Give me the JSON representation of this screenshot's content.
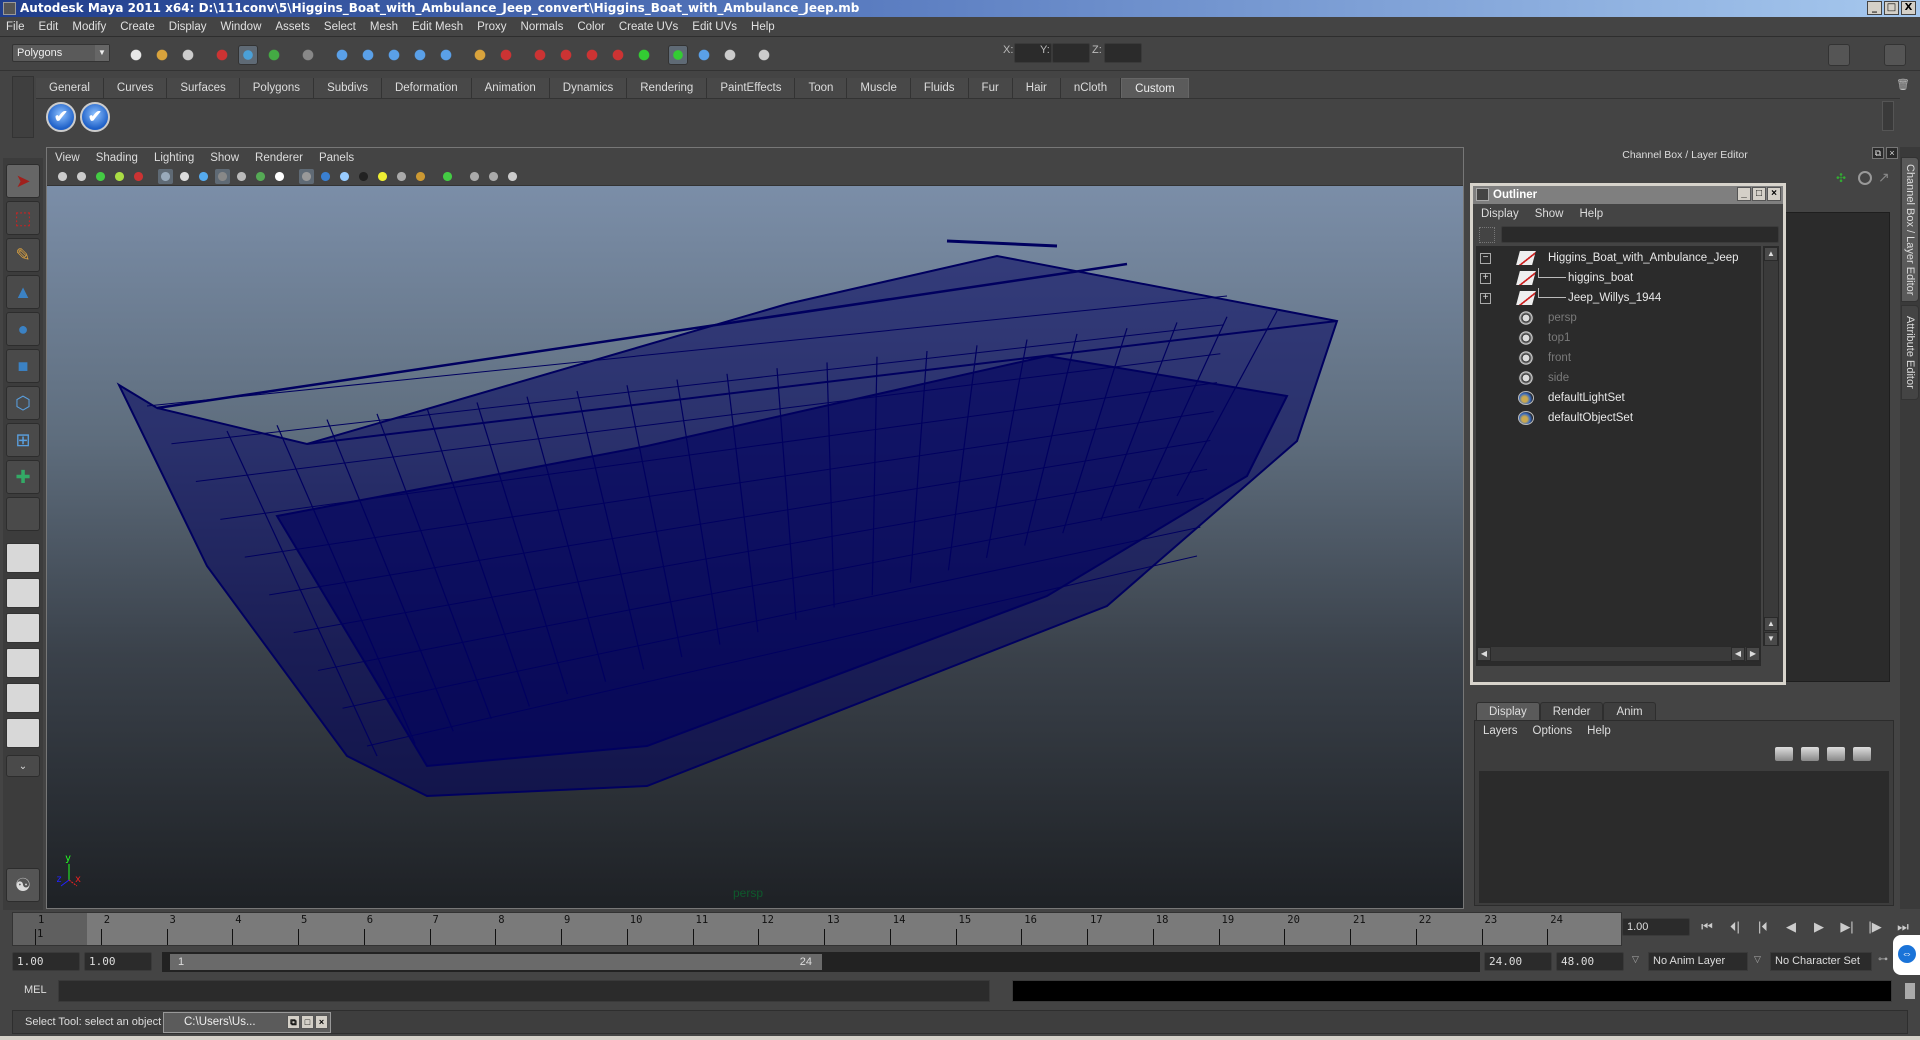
{
  "window": {
    "title": "Autodesk Maya 2011 x64: D:\\111conv\\5\\Higgins_Boat_with_Ambulance_Jeep_convert\\Higgins_Boat_with_Ambulance_Jeep.mb",
    "controls": {
      "minimize": "_",
      "maximize": "□",
      "close": "X"
    }
  },
  "menubar": [
    "File",
    "Edit",
    "Modify",
    "Create",
    "Display",
    "Window",
    "Assets",
    "Select",
    "Mesh",
    "Edit Mesh",
    "Proxy",
    "Normals",
    "Color",
    "Create UVs",
    "Edit UVs",
    "Help"
  ],
  "statusline": {
    "mode": "Polygons",
    "x_label": "X:",
    "y_label": "Y:",
    "z_label": "Z:",
    "x_value": "",
    "y_value": "",
    "z_value": "",
    "icons": [
      "new-scene-icon",
      "open-scene-icon",
      "save-scene-icon",
      "select-hierarchy-icon",
      "select-object-icon",
      "select-component-icon",
      "pick-mask-icon",
      "snap-grid-icon",
      "snap-curve-icon",
      "snap-point-icon",
      "snap-view-plane-icon",
      "snap-live-icon",
      "lock-icon",
      "selection-highlight-icon",
      "history-icon",
      "input-ops-icon",
      "output-ops-icon",
      "construction-history-icon",
      "render-view-icon",
      "render-current-icon",
      "ipr-render-icon",
      "render-settings-icon",
      "input-mode-icon"
    ],
    "right_icons": [
      "attribute-editor-toggle-icon",
      "tool-settings-toggle-icon",
      "channel-box-toggle-icon"
    ]
  },
  "shelf": {
    "tabs": [
      "General",
      "Curves",
      "Surfaces",
      "Polygons",
      "Subdivs",
      "Deformation",
      "Animation",
      "Dynamics",
      "Rendering",
      "PaintEffects",
      "Toon",
      "Muscle",
      "Fluids",
      "Fur",
      "Hair",
      "nCloth",
      "Custom"
    ],
    "active_tab": "Custom",
    "buttons": [
      "✔",
      "✔"
    ]
  },
  "toolbox": {
    "tools": [
      "select-tool-icon",
      "lasso-tool-icon",
      "paint-select-tool-icon",
      "move-tool-icon",
      "rotate-tool-icon",
      "scale-tool-icon",
      "universal-manipulator-icon",
      "soft-modification-icon",
      "show-manipulator-icon",
      "last-tool-icon"
    ],
    "layouts": [
      "single-perspective-layout",
      "four-view-layout",
      "persp-outliner-layout",
      "persp-graph-layout",
      "hypershade-persp-layout",
      "persp-graph-hypergraph-layout"
    ]
  },
  "viewport": {
    "menu": [
      "View",
      "Shading",
      "Lighting",
      "Show",
      "Renderer",
      "Panels"
    ],
    "camera_label": "persp",
    "axis": {
      "x": "x",
      "y": "y",
      "z": "z"
    },
    "wire_color": "#00005f"
  },
  "channel_box": {
    "title": "Channel Box / Layer Editor",
    "vertical_tabs": [
      "Channel Box / Layer Editor",
      "Attribute Editor"
    ]
  },
  "outliner": {
    "title": "Outliner",
    "menu": [
      "Display",
      "Show",
      "Help"
    ],
    "filter": "",
    "items": [
      {
        "label": "Higgins_Boat_with_Ambulance_Jeep",
        "type": "transform",
        "expander": "−",
        "dim": false,
        "depth": 0
      },
      {
        "label": "higgins_boat",
        "type": "transform",
        "expander": "+",
        "dim": false,
        "depth": 1
      },
      {
        "label": "Jeep_Willys_1944",
        "type": "transform",
        "expander": "+",
        "dim": false,
        "depth": 1
      },
      {
        "label": "persp",
        "type": "camera",
        "expander": "",
        "dim": true,
        "depth": 0
      },
      {
        "label": "top1",
        "type": "camera",
        "expander": "",
        "dim": true,
        "depth": 0
      },
      {
        "label": "front",
        "type": "camera",
        "expander": "",
        "dim": true,
        "depth": 0
      },
      {
        "label": "side",
        "type": "camera",
        "expander": "",
        "dim": true,
        "depth": 0
      },
      {
        "label": "defaultLightSet",
        "type": "set",
        "expander": "",
        "dim": false,
        "depth": 0
      },
      {
        "label": "defaultObjectSet",
        "type": "set",
        "expander": "",
        "dim": false,
        "depth": 0
      }
    ]
  },
  "layer_editor": {
    "tabs": [
      "Display",
      "Render",
      "Anim"
    ],
    "active_tab": "Display",
    "menu": [
      "Layers",
      "Options",
      "Help"
    ]
  },
  "timeline": {
    "ticks": [
      "1",
      "2",
      "3",
      "4",
      "5",
      "6",
      "7",
      "8",
      "9",
      "10",
      "11",
      "12",
      "13",
      "14",
      "15",
      "16",
      "17",
      "18",
      "19",
      "20",
      "21",
      "22",
      "23",
      "24"
    ],
    "current_frame_marker": "1",
    "current_frame": "1.00",
    "playback": [
      "⏮",
      "⏴|",
      "|⏴",
      "◀",
      "▶",
      "▶|",
      "|▶",
      "⏭"
    ]
  },
  "range": {
    "start": "1.00",
    "playback_start": "1.00",
    "slider_start": "1",
    "slider_end": "24",
    "playback_end": "24.00",
    "end": "48.00",
    "anim_layer": "No Anim Layer",
    "character_set": "No Character Set"
  },
  "command_line": {
    "label": "MEL",
    "input": "",
    "output": ""
  },
  "help_line": {
    "text": "Select Tool: select an object",
    "minimized_window": "C:\\Users\\Us..."
  }
}
